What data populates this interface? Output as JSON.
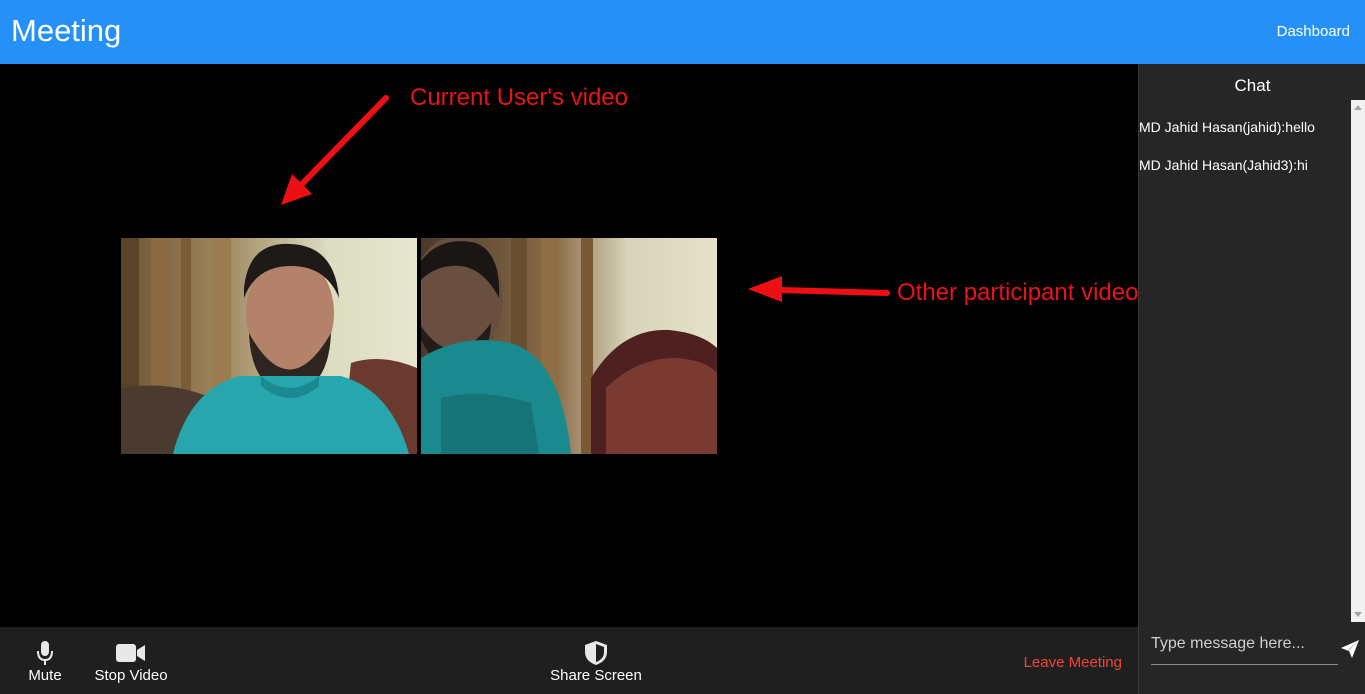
{
  "appbar": {
    "title": "Meeting",
    "dashboard_label": "Dashboard",
    "color": "#2590f5"
  },
  "stage": {
    "annotations": {
      "self_video": "Current User's video",
      "other_video": "Other participant video"
    },
    "annotation_color": "#e8141a"
  },
  "controls": {
    "mute_label": "Mute",
    "stop_video_label": "Stop Video",
    "share_screen_label": "Share Screen",
    "leave_label": "Leave Meeting",
    "leave_color": "#f44336"
  },
  "chat": {
    "title": "Chat",
    "messages": [
      {
        "text": "MD Jahid Hasan(jahid):hello"
      },
      {
        "text": "MD Jahid Hasan(Jahid3):hi"
      }
    ],
    "input_placeholder": "Type message here..."
  },
  "icons": {
    "mute": "microphone-icon",
    "video": "video-camera-icon",
    "share": "shield-icon",
    "send": "send-icon"
  }
}
